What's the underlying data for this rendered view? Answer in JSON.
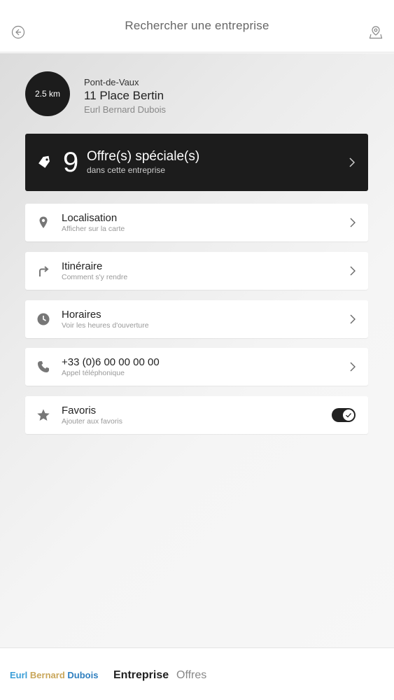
{
  "header": {
    "title": "Rechercher une entreprise"
  },
  "business": {
    "distance": "2.5 km",
    "city": "Pont-de-Vaux",
    "street": "11 Place Bertin",
    "name": "Eurl Bernard Dubois"
  },
  "offers": {
    "count": "9",
    "title": "Offre(s) spéciale(s)",
    "subtitle": "dans cette entreprise"
  },
  "rows": [
    {
      "title": "Localisation",
      "subtitle": "Afficher sur la carte",
      "icon": "location-pin-icon"
    },
    {
      "title": "Itinéraire",
      "subtitle": "Comment s'y rendre",
      "icon": "turn-right-arrow-icon"
    },
    {
      "title": "Horaires",
      "subtitle": "Voir les heures d'ouverture",
      "icon": "clock-icon"
    },
    {
      "title": "+33 (0)6 00 00 00 00",
      "subtitle": "Appel téléphonique",
      "icon": "phone-icon"
    },
    {
      "title": "Favoris",
      "subtitle": "Ajouter aux favoris",
      "icon": "star-icon",
      "toggle_on": true
    }
  ],
  "footer": {
    "brand_part1": "Eurl ",
    "brand_part2": "Bernard ",
    "brand_part3": "Dubois",
    "tab_entreprise": "Entreprise",
    "tab_offres": "Offres"
  },
  "colors": {
    "dark": "#1c1c1c",
    "brand_blue": "#3a9ed8",
    "brand_gold": "#c9a65a"
  }
}
